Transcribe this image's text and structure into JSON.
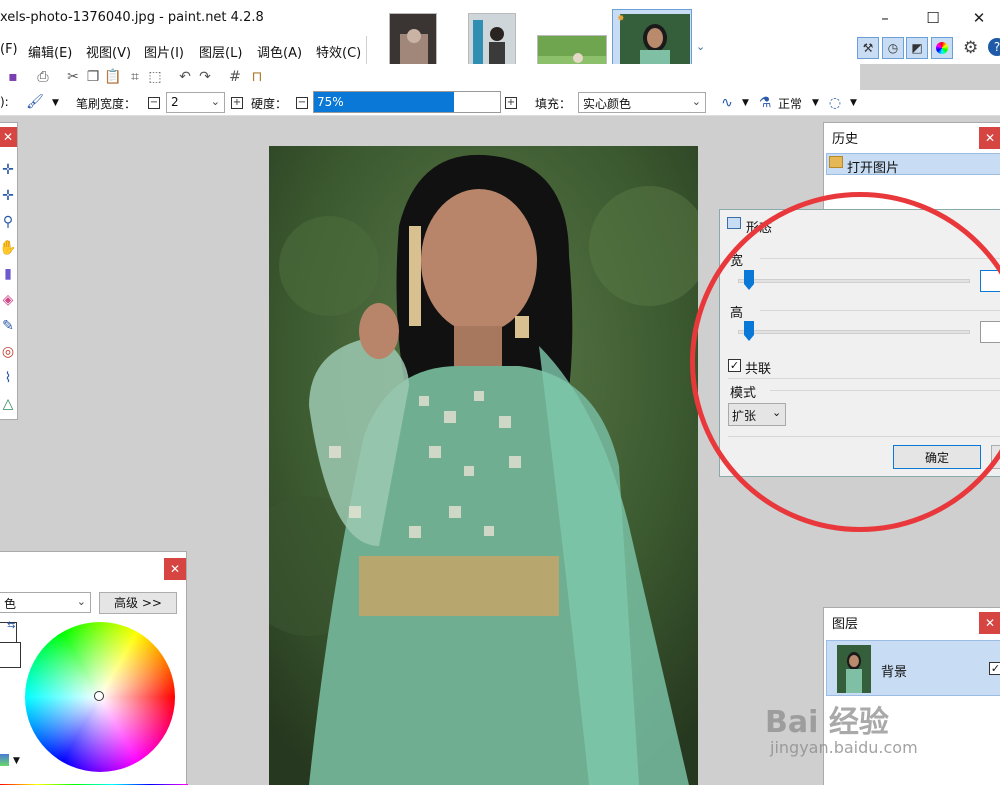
{
  "window": {
    "title": "xels-photo-1376040.jpg - paint.net 4.2.8",
    "minimize": "–",
    "maximize": "☐",
    "close": "✕"
  },
  "menu": {
    "items": [
      "(F)",
      "编辑(E)",
      "视图(V)",
      "图片(I)",
      "图层(L)",
      "调色(A)",
      "特效(C)"
    ]
  },
  "toolbar": {
    "tool_label": "):",
    "brush_width_label": "笔刷宽度：",
    "brush_width_value": "2",
    "hardness_label": "硬度：",
    "hardness_value": "75%",
    "hardness_fraction": 0.75,
    "fill_label": "填充：",
    "fill_value": "实心颜色",
    "blend_value": "正常"
  },
  "history_panel": {
    "title": "历史",
    "items": [
      "打开图片"
    ],
    "close": "✕"
  },
  "dialog": {
    "title": "形态",
    "width_label": "宽",
    "height_label": "高",
    "link_label": "共联",
    "link_checked": "✓",
    "mode_label": "模式",
    "mode_value": "扩张",
    "ok_label": "确定"
  },
  "colors_panel": {
    "mode_value": "色",
    "advanced_label": "高级 >>",
    "close": "✕"
  },
  "layers_panel": {
    "title": "图层",
    "layer_name": "背景",
    "layer_checked": "✓",
    "close": "✕"
  },
  "watermark": {
    "main": "Bai 经验",
    "url": "jingyan.baidu.com"
  },
  "colors": {
    "accent": "#0a78d7",
    "close_red": "#d64541",
    "circle_red": "#e8383b"
  }
}
